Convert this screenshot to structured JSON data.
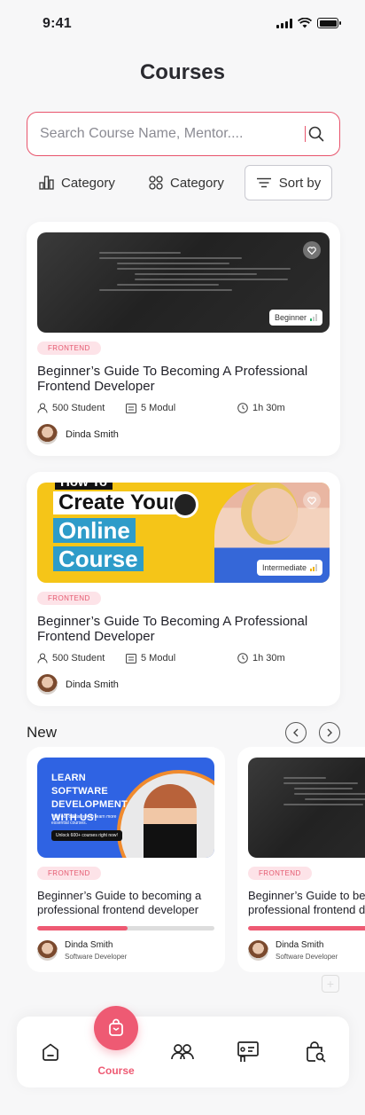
{
  "status": {
    "time": "9:41"
  },
  "header": {
    "title": "Courses"
  },
  "search": {
    "placeholder": "Search Course Name, Mentor...."
  },
  "filters": {
    "category_1": "Category",
    "category_2": "Category",
    "sort": "Sort by"
  },
  "courses": [
    {
      "tag": "FRONTEND",
      "title": "Beginner’s Guide To Becoming A Professional Frontend Developer",
      "students": "500 Student",
      "modules": "5 Modul",
      "duration": "1h 30m",
      "mentor": "Dinda Smith",
      "level": "Beginner",
      "level_value": 1
    },
    {
      "tag": "FRONTEND",
      "title": "Beginner’s Guide To Becoming A Professional Frontend Developer",
      "students": "500 Student",
      "modules": "5 Modul",
      "duration": "1h 30m",
      "mentor": "Dinda Smith",
      "level": "Intermediate",
      "level_value": 2,
      "thumb_text": [
        "How To",
        "Create Your",
        "Online",
        "Course"
      ]
    }
  ],
  "new_section": {
    "title": "New",
    "items": [
      {
        "tag": "FRONTEND",
        "title": "Beginner’s Guide to becoming a professional frontend developer",
        "mentor": "Dinda Smith",
        "role": "Software Developer",
        "progress_pct": 51,
        "thumb_headline": "LEARN SOFTWARE DEVELOPMENT WITH US!",
        "thumb_sub": "Visit our official site to learn more essential courses.",
        "thumb_pill": "Unlock 600+ courses right now!"
      },
      {
        "tag": "FRONTEND",
        "title": "Beginner’s Guide to becoming a professional frontend developer",
        "mentor": "Dinda Smith",
        "role": "Software Developer",
        "progress_pct": 75
      }
    ]
  },
  "bottom_nav": {
    "active_label": "Course"
  },
  "colors": {
    "accent": "#ee5a73",
    "tag_bg": "#fde3e8",
    "search_border": "#e8546c"
  }
}
